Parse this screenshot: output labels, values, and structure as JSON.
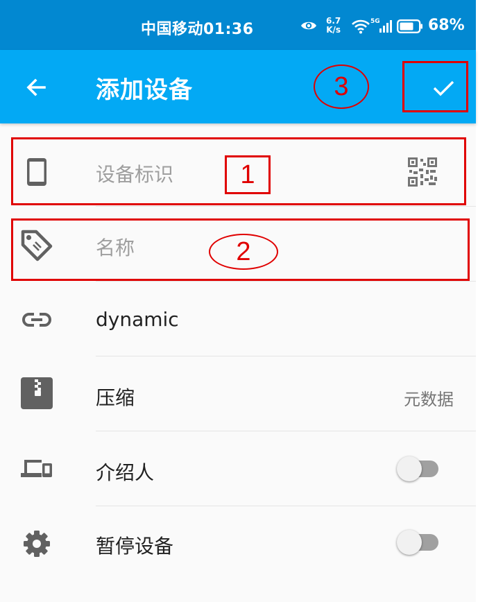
{
  "status_bar": {
    "carrier_time": "中国移动01:36",
    "net_speed_value": "6.7",
    "net_speed_unit": "K/s",
    "network_type": "5G",
    "battery_percent": "68%",
    "icons": [
      "eye-icon",
      "wifi-icon",
      "signal-icon",
      "battery-icon"
    ]
  },
  "toolbar": {
    "title": "添加设备",
    "back_icon": "arrow-left-icon",
    "confirm_icon": "check-icon"
  },
  "form": {
    "device_id": {
      "placeholder": "设备标识",
      "icon": "phone-icon",
      "action_icon": "qr-code-icon"
    },
    "name": {
      "placeholder": "名称",
      "icon": "tag-icon"
    },
    "address": {
      "value": "dynamic",
      "icon": "link-icon"
    },
    "compression": {
      "label": "压缩",
      "value": "元数据",
      "icon": "archive-icon"
    },
    "introducer": {
      "label": "介绍人",
      "checked": false,
      "icon": "devices-icon"
    },
    "pause": {
      "label": "暂停设备",
      "checked": false,
      "icon": "gear-icon"
    }
  },
  "annotations": [
    {
      "number": "1",
      "target": "device-id-field"
    },
    {
      "number": "2",
      "target": "name-field"
    },
    {
      "number": "3",
      "target": "confirm-button"
    }
  ],
  "colors": {
    "status_bar": "#0288d1",
    "toolbar": "#03a9f4",
    "annotation": "#e00000",
    "icon": "#616161"
  }
}
